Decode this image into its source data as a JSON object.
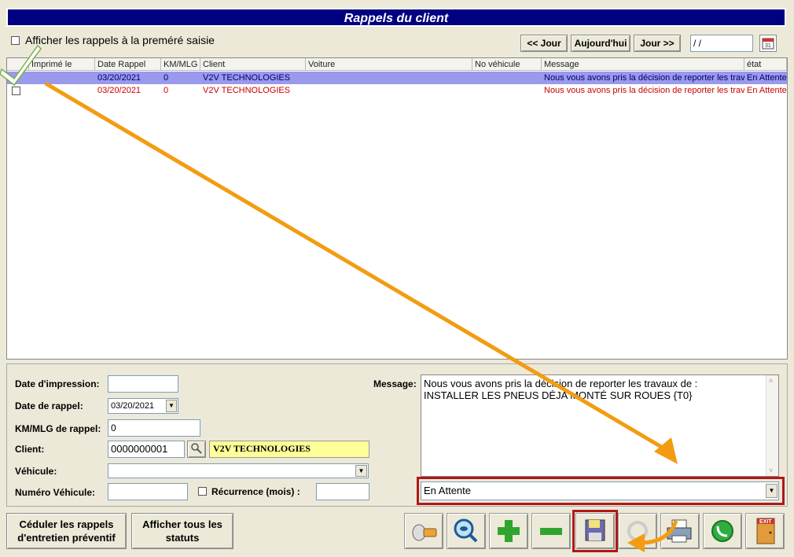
{
  "window": {
    "title": "Rappels du client"
  },
  "topbar": {
    "show_first_entry_label": "Afficher les rappels à  la preméré saisie",
    "prev_day_label": "<< Jour",
    "today_label": "Aujourd'hui",
    "next_day_label": "Jour >>",
    "date_value": "/ /"
  },
  "grid": {
    "columns": [
      "Imprimé le",
      "Date Rappel",
      "KM/MLG",
      "Client",
      "Voiture",
      "No véhicule",
      "Message",
      "état"
    ],
    "rows": [
      {
        "printed": "",
        "date": "03/20/2021",
        "km": "0",
        "client": "V2V TECHNOLOGIES",
        "car": "",
        "vehicle_no": "",
        "message": "Nous vous avons pris la décision de reporter les travaux",
        "state": "En Attente",
        "selected": true
      },
      {
        "printed": "",
        "date": "03/20/2021",
        "km": "0",
        "client": "V2V TECHNOLOGIES",
        "car": "",
        "vehicle_no": "",
        "message": "Nous vous avons pris la décision de reporter les travaux",
        "state": "En Attente",
        "selected": false
      }
    ]
  },
  "form": {
    "print_date_label": "Date d'impression:",
    "print_date_value": "",
    "reminder_date_label": "Date de rappel:",
    "reminder_date_value": "03/20/2021",
    "km_label": "KM/MLG de rappel:",
    "km_value": "0",
    "client_label": "Client:",
    "client_id": "0000000001",
    "client_name": "V2V TECHNOLOGIES",
    "vehicle_label": "Véhicule:",
    "vehicle_value": "",
    "vehicle_no_label": "Numéro Véhicule:",
    "vehicle_no_value": "",
    "recurrence_label": "Récurrence (mois) :",
    "recurrence_value": "",
    "message_label": "Message:",
    "message_line1": "Nous vous avons pris la décision de reporter les travaux de :",
    "message_line2": "INSTALLER LES PNEUS DÉJA MONTÉ SUR ROUES {T0}",
    "status_value": "En Attente"
  },
  "footer": {
    "schedule_button_line1": "Céduler les rappels",
    "schedule_button_line2": "d'entretien préventif",
    "show_all_line1": "Afficher tous les",
    "show_all_line2": "statuts",
    "exit_icon_text": "EXIT"
  },
  "colors": {
    "title_bg": "#000080",
    "selected_row": "#9999ee",
    "reminder_text": "#cc0000",
    "client_highlight": "#ffff99",
    "annotation_arrow": "#f39c12",
    "annotation_box": "#b01818"
  }
}
